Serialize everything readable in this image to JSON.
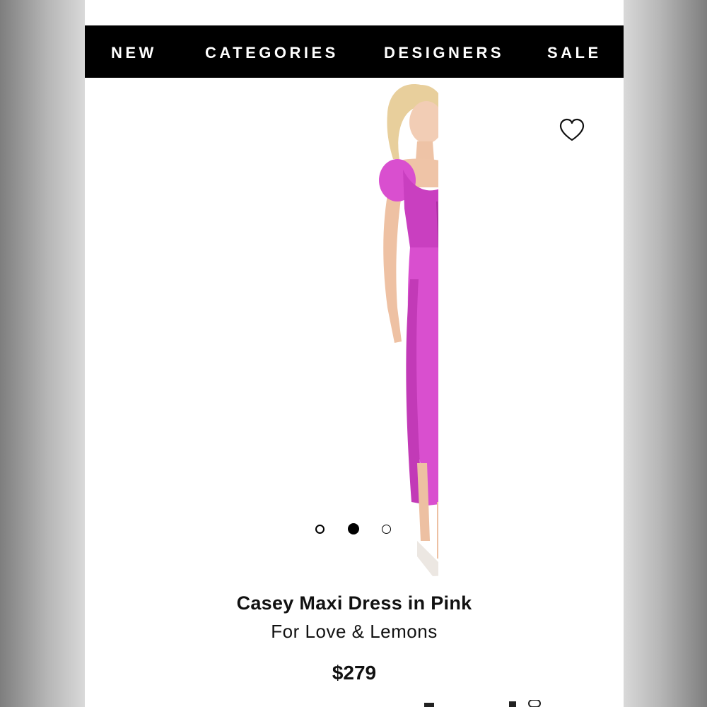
{
  "nav": {
    "items": [
      {
        "label": "NEW"
      },
      {
        "label": "CATEGORIES"
      },
      {
        "label": "DESIGNERS"
      },
      {
        "label": "SALE"
      }
    ]
  },
  "product": {
    "name": "Casey Maxi Dress in Pink",
    "brand": "For Love & Lemons",
    "price": "$279",
    "image_icon": "product-photo",
    "dress_color": "#d94fcf"
  },
  "gallery": {
    "total_images": 3,
    "active_index": 2
  },
  "colors": {
    "nav_bg": "#000000",
    "nav_text": "#ffffff",
    "text": "#111111"
  },
  "icons": {
    "wishlist": "heart-outline-icon"
  }
}
